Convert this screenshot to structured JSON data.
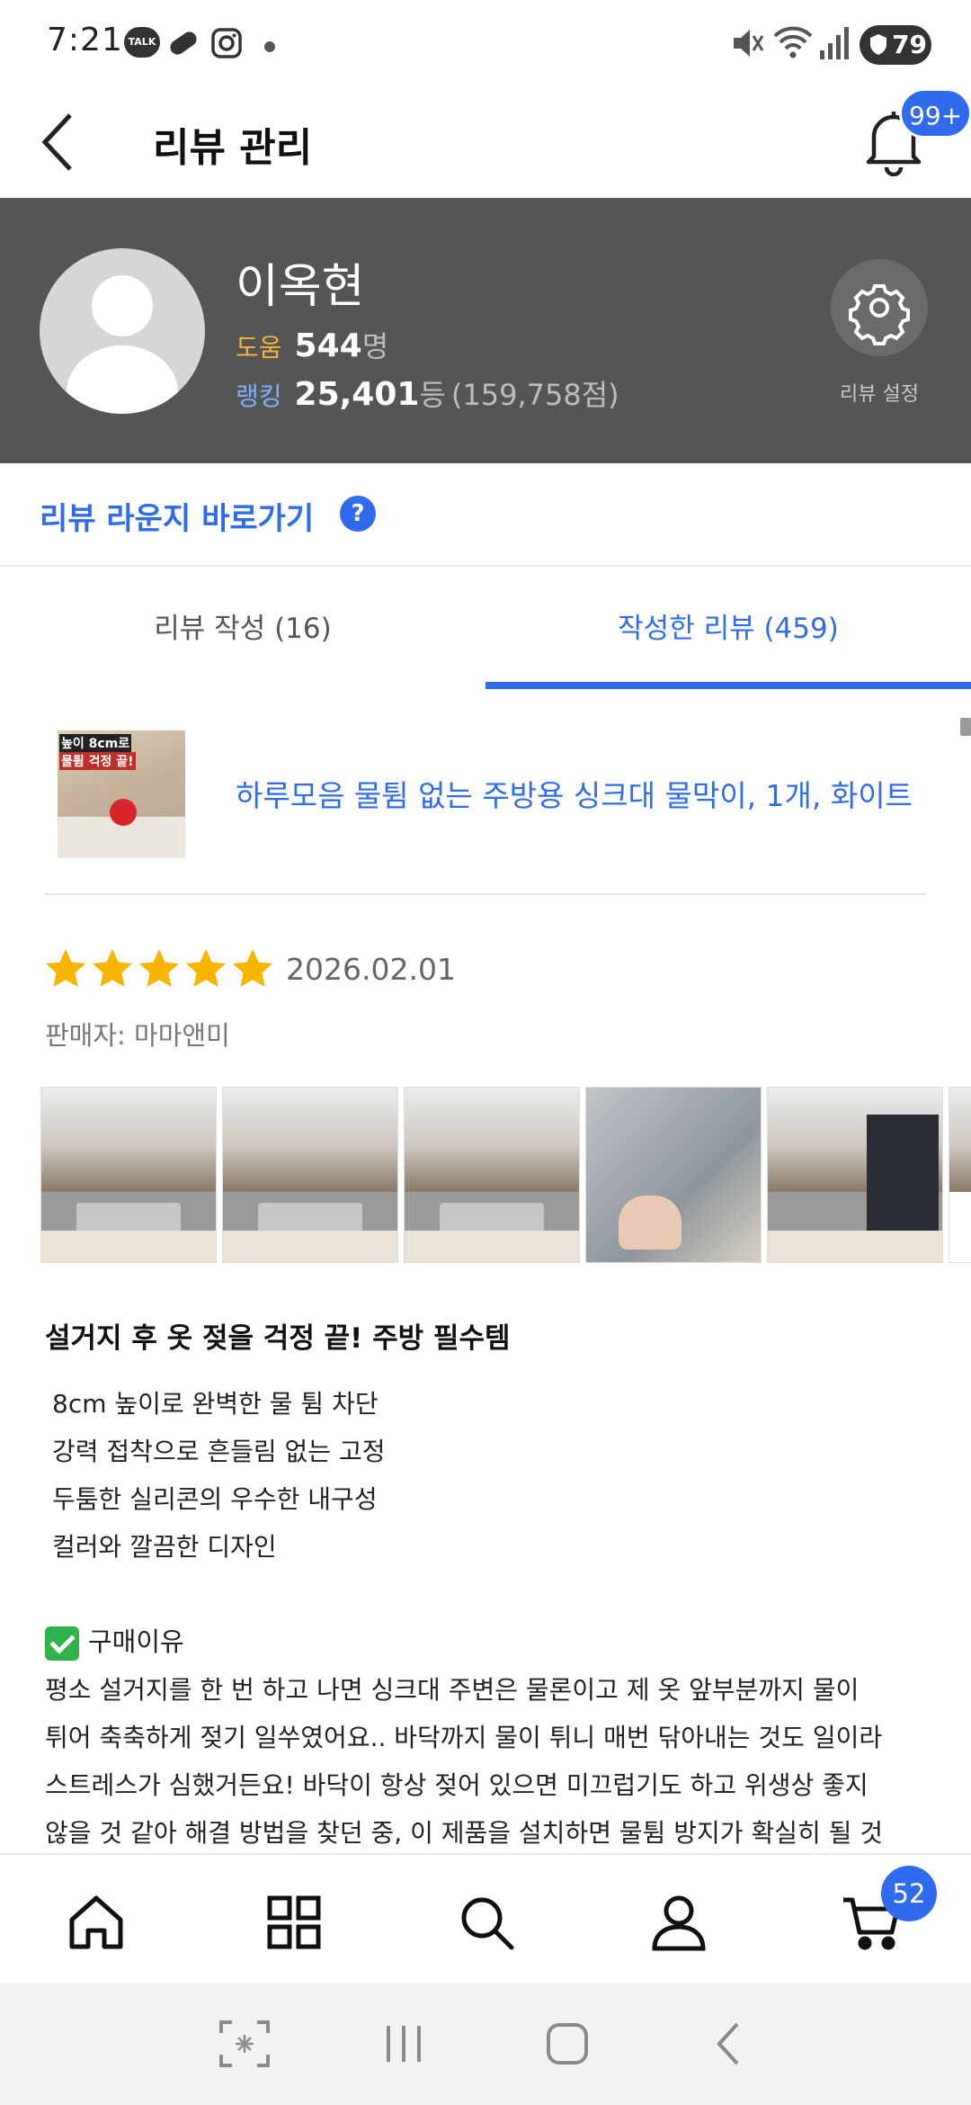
{
  "status_bar": {
    "time": "7:21",
    "talk_label": "TALK",
    "battery": "79"
  },
  "header": {
    "title": "리뷰 관리",
    "notification_badge": "99+"
  },
  "profile": {
    "name": "이옥현",
    "help_label": "도움",
    "help_value": "544",
    "help_unit": "명",
    "rank_label": "랭킹",
    "rank_value": "25,401",
    "rank_unit": "등",
    "rank_points": "(159,758점)",
    "settings_label": "리뷰 설정"
  },
  "lounge": {
    "label": "리뷰 라운지 바로가기",
    "help_mark": "?"
  },
  "tabs": [
    {
      "label": "리뷰 작성 (16)",
      "active": false
    },
    {
      "label": "작성한 리뷰 (459)",
      "active": true
    }
  ],
  "product": {
    "thumb_tag_1": "높이 8cm로",
    "thumb_tag_2": "물튐 걱정 끝!",
    "title": "하루모음 물튐 없는 주방용 싱크대 물막이, 1개, 화이트"
  },
  "review": {
    "rating": 5,
    "date": "2026.02.01",
    "seller": "판매자: 마마앤미",
    "heading": "설거지 후 옷 젖을 걱정 끝! 주방 필수템",
    "bullets": [
      "8cm 높이로 완벽한 물 튐 차단",
      "강력 접착으로 흔들림 없는 고정",
      "두툼한 실리콘의 우수한 내구성",
      "컬러와 깔끔한 디자인"
    ],
    "reason_title": "구매이유",
    "body_lines": [
      "평소 설거지를 한 번 하고 나면 싱크대 주변은 물론이고 제 옷 앞부분까지 물이",
      "튀어 축축하게 젖기 일쑤였어요.. 바닥까지 물이 튀니 매번 닦아내는 것도 일이라",
      "스트레스가 심했거든요! 바닥이 항상 젖어 있으면 미끄럽기도 하고 위생상 좋지",
      "않을 것 같아 해결 방법을 찾던 중, 이 제품을 설치하면 물튐 방지가 확실히 될 것"
    ]
  },
  "bottom_nav": {
    "items": [
      "home-icon",
      "grid-icon",
      "search-icon",
      "person-icon",
      "cart-icon"
    ],
    "cart_badge": "52"
  },
  "colors": {
    "accent": "#2f6bec",
    "profile_bg": "#555555",
    "star": "#f7b500",
    "help_label": "#f5b33d",
    "rank_label": "#7fb0ff"
  }
}
